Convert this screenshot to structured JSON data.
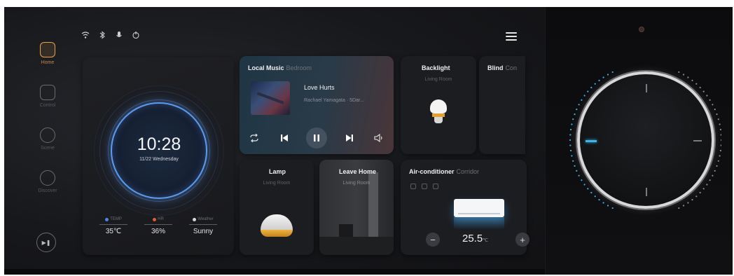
{
  "status_icons": [
    "wifi-icon",
    "bluetooth-icon",
    "microphone-icon",
    "power-icon"
  ],
  "nav": {
    "items": [
      {
        "label": "Home",
        "icon": "home-icon",
        "active": true
      },
      {
        "label": "Control",
        "icon": "monitor-icon",
        "active": false
      },
      {
        "label": "Scene",
        "icon": "play-circle-icon",
        "active": false
      },
      {
        "label": "Discover",
        "icon": "compass-icon",
        "active": false
      }
    ],
    "bottom_icon": "media-icon"
  },
  "clock": {
    "time": "10:28",
    "date": "11/22 Wednesday",
    "stats": [
      {
        "key": "TEMP",
        "value": "35℃",
        "color": "#4a86e8"
      },
      {
        "key": "HR",
        "value": "36%",
        "color": "#e25a3a"
      },
      {
        "key": "Weather",
        "value": "Sunny",
        "color": "#d8d8d8"
      }
    ]
  },
  "music": {
    "title": "Local Music",
    "source": "Bedroom",
    "song": "Love Hurts",
    "artist": "Rachael Yamagata · 5Dar...",
    "controls": [
      "repeat-icon",
      "previous-icon",
      "pause-icon",
      "next-icon",
      "volume-icon"
    ]
  },
  "backlight": {
    "title": "Backlight",
    "room": "Living Room",
    "icon": "bulb-icon"
  },
  "blind": {
    "title": "Blind",
    "room": "Con"
  },
  "lamp": {
    "title": "Lamp",
    "room": "Living Room",
    "icon": "lamp-icon"
  },
  "leave_home": {
    "title": "Leave Home",
    "room": "Living Room"
  },
  "aircon": {
    "title": "Air-conditioner",
    "room": "Corridor",
    "temp": "25.5",
    "unit": "℃",
    "minus": "−",
    "plus": "+",
    "modes": [
      "snowflake-icon",
      "fan-icon",
      "timer-icon"
    ]
  },
  "colors": {
    "accent_orange": "#e7a24b",
    "clock_blue": "#5b9cf0",
    "knob_cyan": "#3ab7e8"
  }
}
